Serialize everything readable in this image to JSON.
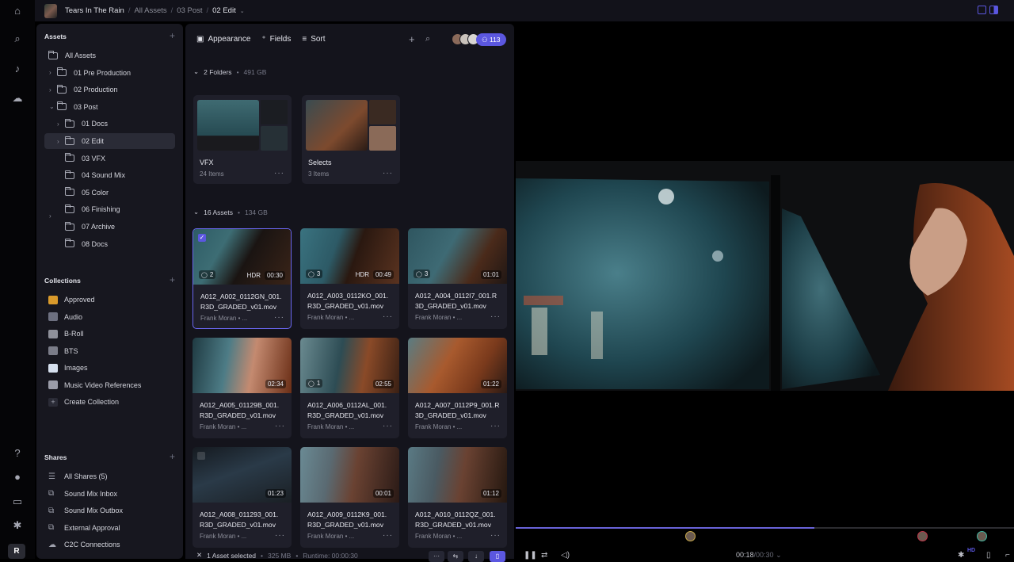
{
  "app": {
    "project": "Tears In The Rain",
    "breadcrumbs": [
      "All Assets",
      "03 Post",
      "02 Edit"
    ]
  },
  "rail": {
    "icons": [
      "home-icon",
      "search-icon",
      "bell-icon",
      "cloud-upload-icon",
      "help-icon",
      "lightbulb-icon",
      "keyboard-icon",
      "gear-icon",
      "logo-icon"
    ]
  },
  "sidebar": {
    "assets_title": "Assets",
    "tree": [
      {
        "label": "All Assets",
        "level": 0,
        "chevron": ""
      },
      {
        "label": "01 Pre Production",
        "level": 1,
        "chevron": "›"
      },
      {
        "label": "02 Production",
        "level": 1,
        "chevron": "›"
      },
      {
        "label": "03 Post",
        "level": 1,
        "chevron": "⌄"
      },
      {
        "label": "01 Docs",
        "level": 2,
        "chevron": "›"
      },
      {
        "label": "02 Edit",
        "level": 2,
        "chevron": "›",
        "selected": true
      },
      {
        "label": "03 VFX",
        "level": 2,
        "chevron": ""
      },
      {
        "label": "04 Sound Mix",
        "level": 2,
        "chevron": ""
      },
      {
        "label": "05 Color",
        "level": 2,
        "chevron": ""
      },
      {
        "label": "06 Finishing",
        "level": 2,
        "chevron": ""
      },
      {
        "label": "07 Archive",
        "level": 2,
        "chevron": ""
      },
      {
        "label": "08 Docs",
        "level": 2,
        "chevron": ""
      }
    ],
    "collections_title": "Collections",
    "collections": [
      {
        "label": "Approved",
        "icon": "party-popper-icon",
        "color": "#d99a2b"
      },
      {
        "label": "Audio",
        "icon": "snail-icon",
        "color": "#6d7080"
      },
      {
        "label": "B-Roll",
        "icon": "clapper-icon",
        "color": "#8e909a"
      },
      {
        "label": "BTS",
        "icon": "film-frames-icon",
        "color": "#7a7c88"
      },
      {
        "label": "Images",
        "icon": "picture-icon",
        "color": "#d6e0ee"
      },
      {
        "label": "Music Video References",
        "icon": "vhs-icon",
        "color": "#9a9ca8"
      },
      {
        "label": "Create Collection",
        "icon": "plus-icon",
        "color": "#2a2b36"
      }
    ],
    "shares_title": "Shares",
    "shares": [
      {
        "label": "All Shares (5)",
        "icon": "list-icon"
      },
      {
        "label": "Sound Mix Inbox",
        "icon": "share-box-icon"
      },
      {
        "label": "Sound Mix Outbox",
        "icon": "share-box-icon"
      },
      {
        "label": "External Approval",
        "icon": "share-box-icon"
      },
      {
        "label": "C2C Connections",
        "icon": "cloud-icon"
      }
    ]
  },
  "toolbar": {
    "appearance": "Appearance",
    "fields": "Fields",
    "sort": "Sort",
    "members_count": "113"
  },
  "folders_group": {
    "title": "2 Folders",
    "size": "491 GB"
  },
  "folders": [
    {
      "name": "VFX",
      "count": "24 Items"
    },
    {
      "name": "Selects",
      "count": "3 Items"
    }
  ],
  "assets_group": {
    "title": "16 Assets",
    "size": "134 GB"
  },
  "assets": [
    {
      "name": "A012_A002_0112GN_001.R3D_GRADED_v01.mov",
      "line1": "A012_A002_0112GN_001.",
      "line2": "R3D_GRADED_v01.mov",
      "owner": "Frank Moran",
      "comments": "2",
      "hdr": "HDR",
      "duration": "00:30",
      "selected": true
    },
    {
      "name": "A012_A003_0112KO_001.R3D_GRADED_v01.mov",
      "line1": "A012_A003_0112KO_001.",
      "line2": "R3D_GRADED_v01.mov",
      "owner": "Frank Moran",
      "comments": "3",
      "hdr": "HDR",
      "duration": "00:49"
    },
    {
      "name": "A012_A004_0112I7_001.R3D_GRADED_v01.mov",
      "line1": "A012_A004_0112I7_001.R",
      "line2": "3D_GRADED_v01.mov",
      "owner": "Frank Moran",
      "comments": "3",
      "hdr": "",
      "duration": "01:01"
    },
    {
      "name": "A012_A005_01129B_001.R3D_GRADED_v01.mov",
      "line1": "A012_A005_01129B_001.",
      "line2": "R3D_GRADED_v01.mov",
      "owner": "Frank Moran",
      "comments": "",
      "hdr": "",
      "duration": "02:34"
    },
    {
      "name": "A012_A006_0112AL_001.R3D_GRADED_v01.mov",
      "line1": "A012_A006_0112AL_001.",
      "line2": "R3D_GRADED_v01.mov",
      "owner": "Frank Moran",
      "comments": "1",
      "hdr": "",
      "duration": "02:55"
    },
    {
      "name": "A012_A007_0112P9_001.R3D_GRADED_v01.mov",
      "line1": "A012_A007_0112P9_001.R",
      "line2": "3D_GRADED_v01.mov",
      "owner": "Frank Moran",
      "comments": "",
      "hdr": "",
      "duration": "01:22"
    },
    {
      "name": "A012_A008_011293_001.R3D_GRADED_v01.mov",
      "line1": "A012_A008_011293_001.",
      "line2": "R3D_GRADED_v01.mov",
      "owner": "Frank Moran",
      "comments": "",
      "hdr": "",
      "duration": "01:23"
    },
    {
      "name": "A012_A009_0112K9_001.R3D_GRADED_v01.mov",
      "line1": "A012_A009_0112K9_001.",
      "line2": "R3D_GRADED_v01.mov",
      "owner": "Frank Moran",
      "comments": "",
      "hdr": "",
      "duration": "00:01"
    },
    {
      "name": "A012_A010_0112QZ_001.R3D_GRADED_v01.mov",
      "line1": "A012_A010_0112QZ_001.",
      "line2": "R3D_GRADED_v01.mov",
      "owner": "Frank Moran",
      "comments": "",
      "hdr": "",
      "duration": "01:12"
    }
  ],
  "selection_bar": {
    "text": "1 Asset selected",
    "size": "325 MB",
    "runtime": "Runtime: 00:00:30"
  },
  "player": {
    "current": "00:18",
    "total": "/00:30",
    "progress": 0.6,
    "quality": "HD",
    "markers": [
      {
        "pos": 0.35,
        "color": "#c8a94a"
      },
      {
        "pos": 0.815,
        "color": "#c0364a"
      },
      {
        "pos": 0.935,
        "color": "#3fb6a0"
      }
    ]
  },
  "colors": {
    "accent": "#5b57e0",
    "panel": "#17171f",
    "card": "#1f1f2a"
  }
}
